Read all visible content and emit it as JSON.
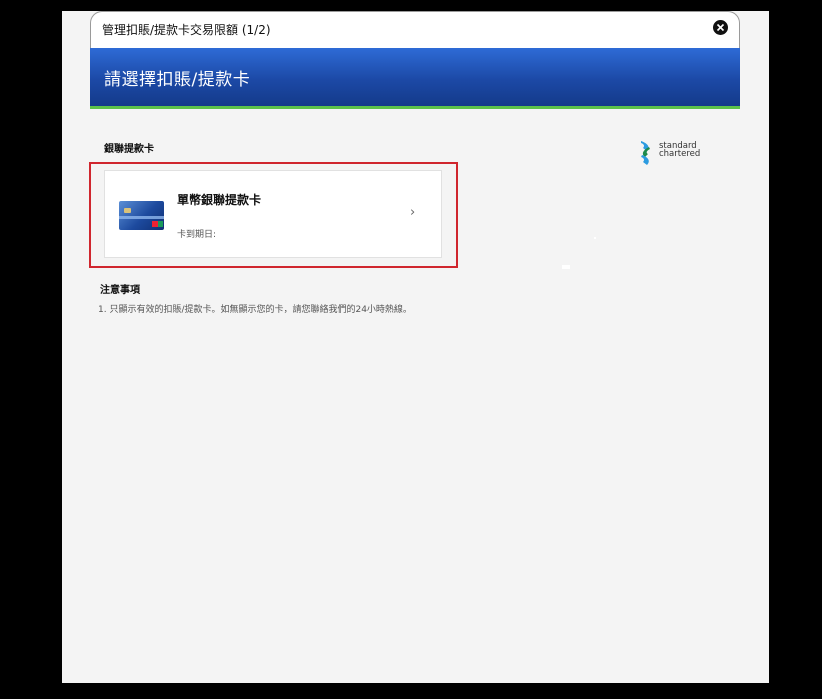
{
  "modal": {
    "title": "管理扣賬/提款卡交易限額 (1/2)",
    "close_icon": "close-icon"
  },
  "banner": {
    "title": "請選擇扣賬/提款卡",
    "accent_color": "#1c49a6",
    "stripe_color": "#5cc24a"
  },
  "section": {
    "label": "銀聯提款卡"
  },
  "logo": {
    "line1": "standard",
    "line2": "chartered"
  },
  "cards": [
    {
      "name": "單幣銀聯提款卡",
      "expiry_label": "卡到期日:",
      "icon": "chevron-right-icon"
    }
  ],
  "notes": {
    "title": "注意事項",
    "items": [
      "1.  只顯示有效的扣賬/提款卡。如無顯示您的卡，請您聯絡我們的24小時熱線。"
    ]
  },
  "highlight_color": "#d0262e"
}
